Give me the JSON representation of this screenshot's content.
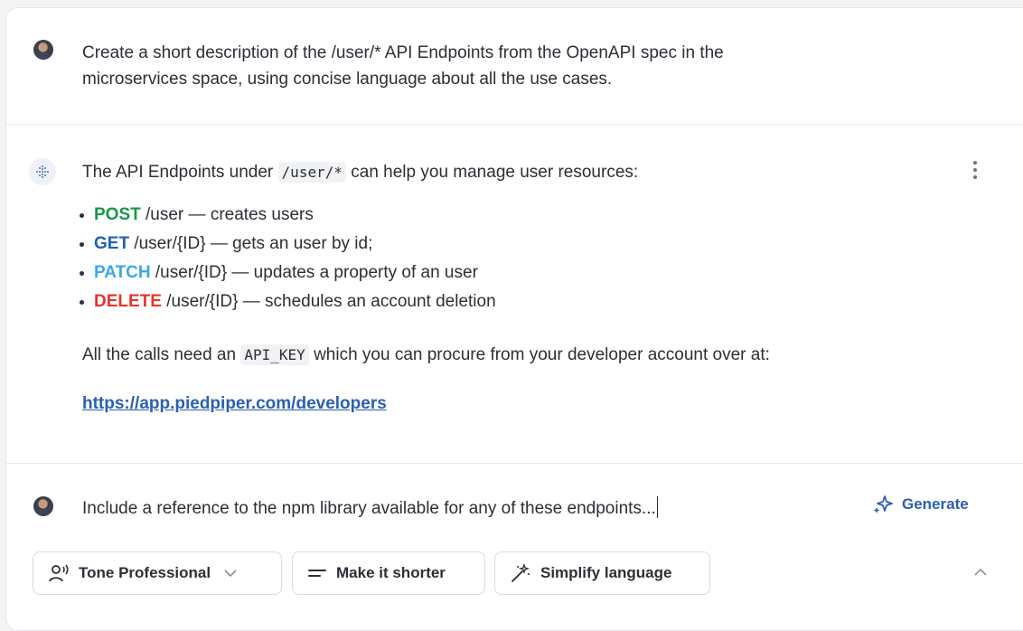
{
  "conversation": {
    "user_prompt": {
      "line1": "Create a short description of the /user/* API Endpoints from the OpenAPI spec in the",
      "line2": "microservices space, using concise language about all the use cases."
    },
    "ai_response": {
      "intro_before": "The API Endpoints under",
      "intro_code": "/user/*",
      "intro_after": "can help you manage user resources:",
      "endpoints": [
        {
          "method": "POST",
          "path": " /user",
          "desc": " — creates users"
        },
        {
          "method": "GET",
          "path": " /user/{ID}",
          "desc": " — gets an user by id;"
        },
        {
          "method": "PATCH",
          "path": " /user/{ID}",
          "desc": " — updates a property of an user"
        },
        {
          "method": "DELETE",
          "path": " /user/{ID}",
          "desc": " — schedules an account deletion"
        }
      ],
      "note_before": "All the calls need an",
      "note_code": "API_KEY",
      "note_after": "which you can procure from your developer account over at:",
      "link": "https://app.piedpiper.com/developers"
    }
  },
  "composer": {
    "input_value": "Include a reference to the npm library available for any of these endpoints...",
    "generate_label": "Generate",
    "chips": {
      "tone_label": "Tone Professional",
      "shorter_label": "Make it shorter",
      "simplify_label": "Simplify language"
    }
  },
  "colors": {
    "post": "#17964a",
    "get": "#1f62b5",
    "patch": "#3aa9e4",
    "delete": "#e2352b",
    "link": "#2a5fb0"
  },
  "icons": {
    "user_avatar": "user-avatar",
    "ai": "ai-dots-icon",
    "more": "kebab-menu-icon",
    "generate": "sparkles-icon",
    "tone": "voice-person-icon",
    "shorter": "lines-icon",
    "simplify": "magic-wand-icon",
    "tone_dropdown": "chevron-down-icon",
    "collapse": "chevron-up-icon"
  }
}
